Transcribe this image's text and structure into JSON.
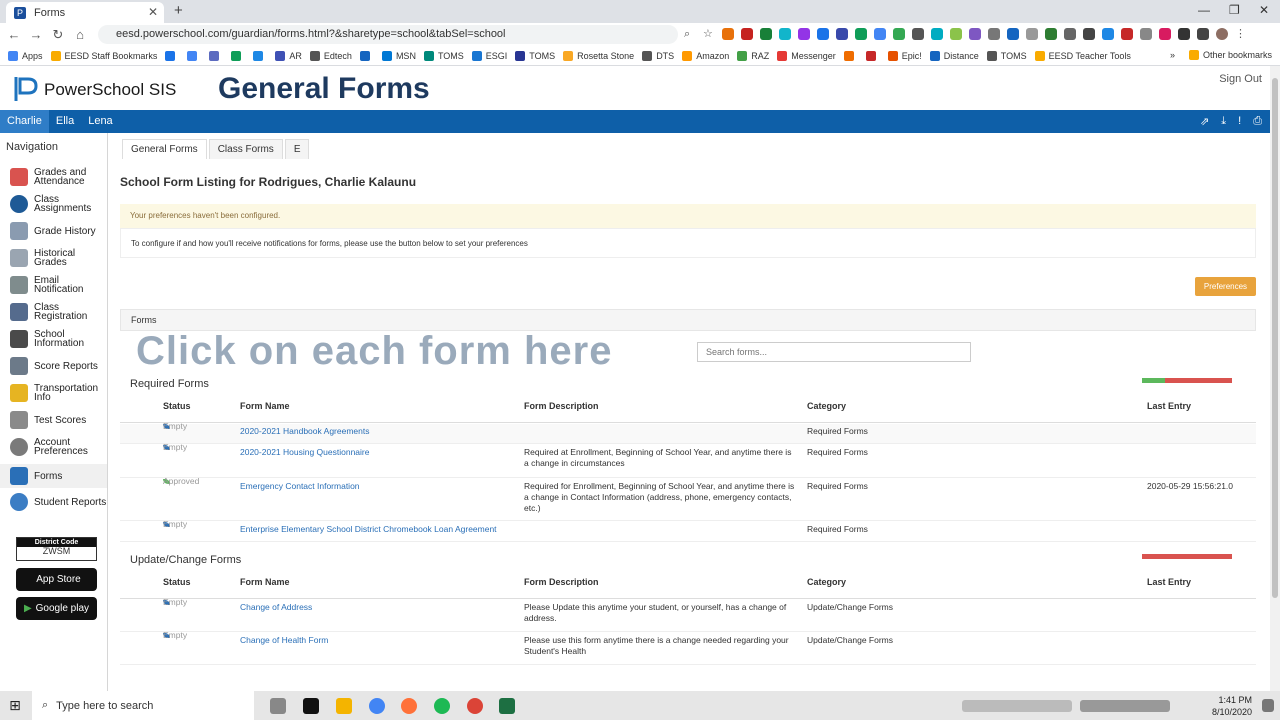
{
  "browser": {
    "tab_title": "Forms",
    "url": "eesd.powerschool.com/guardian/forms.html?&sharetype=school&tabSel=school",
    "bookmarks": [
      "Apps",
      "EESD Staff Bookmarks",
      "AR",
      "Edtech",
      "MSN",
      "TOMS",
      "ESGI",
      "TOMS",
      "Rosetta Stone",
      "DTS",
      "Amazon",
      "RAZ",
      "Messenger",
      "Epic!",
      "Distance",
      "TOMS",
      "EESD Teacher Tools"
    ],
    "other_bookmarks": "Other bookmarks"
  },
  "header": {
    "app_name": "PowerSchool SIS",
    "overlay_title": "General Forms",
    "sign_out": "Sign Out",
    "students": [
      "Charlie",
      "Ella",
      "Lena"
    ]
  },
  "nav": {
    "heading": "Navigation",
    "items": [
      "Grades and Attendance",
      "Class Assignments",
      "Grade History",
      "Historical Grades",
      "Email Notification",
      "Class Registration",
      "School Information",
      "Score Reports",
      "Transportation Info",
      "Test Scores",
      "Account Preferences",
      "Forms",
      "Student Reports"
    ],
    "district_code_label": "District Code",
    "district_code": "ZWSM",
    "app_store": "App Store",
    "google_play": "Google play"
  },
  "main": {
    "tabs": [
      "General Forms",
      "Class Forms",
      "E"
    ],
    "listing_title": "School Form Listing for Rodrigues, Charlie Kalaunu",
    "pref_warning": "Your preferences haven't been configured.",
    "pref_info": "To configure if and how you'll receive notifications for forms, please use the button below to set your preferences",
    "preferences_button": "Preferences",
    "forms_panel": "Forms",
    "overlay_click": "Click on each form here",
    "search_placeholder": "Search forms...",
    "columns": [
      "Status",
      "Form Name",
      "Form Description",
      "Category",
      "Last Entry"
    ],
    "required_title": "Required Forms",
    "required_forms": [
      {
        "status": "Empty",
        "name": "2020-2021 Handbook Agreements",
        "desc": "",
        "category": "Required Forms",
        "last": ""
      },
      {
        "status": "Empty",
        "name": "2020-2021 Housing Questionnaire",
        "desc": "Required at Enrollment, Beginning of School Year, and anytime there is a change in circumstances",
        "category": "Required Forms",
        "last": ""
      },
      {
        "status": "Approved",
        "name": "Emergency Contact Information",
        "desc": "Required for Enrollment, Beginning of School Year, and anytime there is a change in Contact Information (address, phone, emergency contacts, etc.)",
        "category": "Required Forms",
        "last": "2020-05-29 15:56:21.0"
      },
      {
        "status": "Empty",
        "name": "Enterprise Elementary School District Chromebook Loan Agreement",
        "desc": "",
        "category": "Required Forms",
        "last": ""
      }
    ],
    "required_progress": {
      "complete": 0.25
    },
    "update_title": "Update/Change Forms",
    "update_forms": [
      {
        "status": "Empty",
        "name": "Change of Address",
        "desc": "Please Update this anytime your student, or yourself, has a change of address.",
        "category": "Update/Change Forms",
        "last": ""
      },
      {
        "status": "Empty",
        "name": "Change of Health Form",
        "desc": "Please use this form anytime there is a change needed regarding your Student's Health",
        "category": "Update/Change Forms",
        "last": ""
      }
    ],
    "update_progress": {
      "complete": 0
    }
  },
  "taskbar": {
    "search_placeholder": "Type here to search",
    "time": "1:41 PM",
    "date": "8/10/2020"
  },
  "colors": {
    "brand_blue": "#0e5fa8",
    "link": "#2a6fb7",
    "warning_bg": "#fcf8e3",
    "preferences_btn": "#e8a33c",
    "progress_done": "#5cb85c",
    "progress_todo": "#d9534f"
  }
}
